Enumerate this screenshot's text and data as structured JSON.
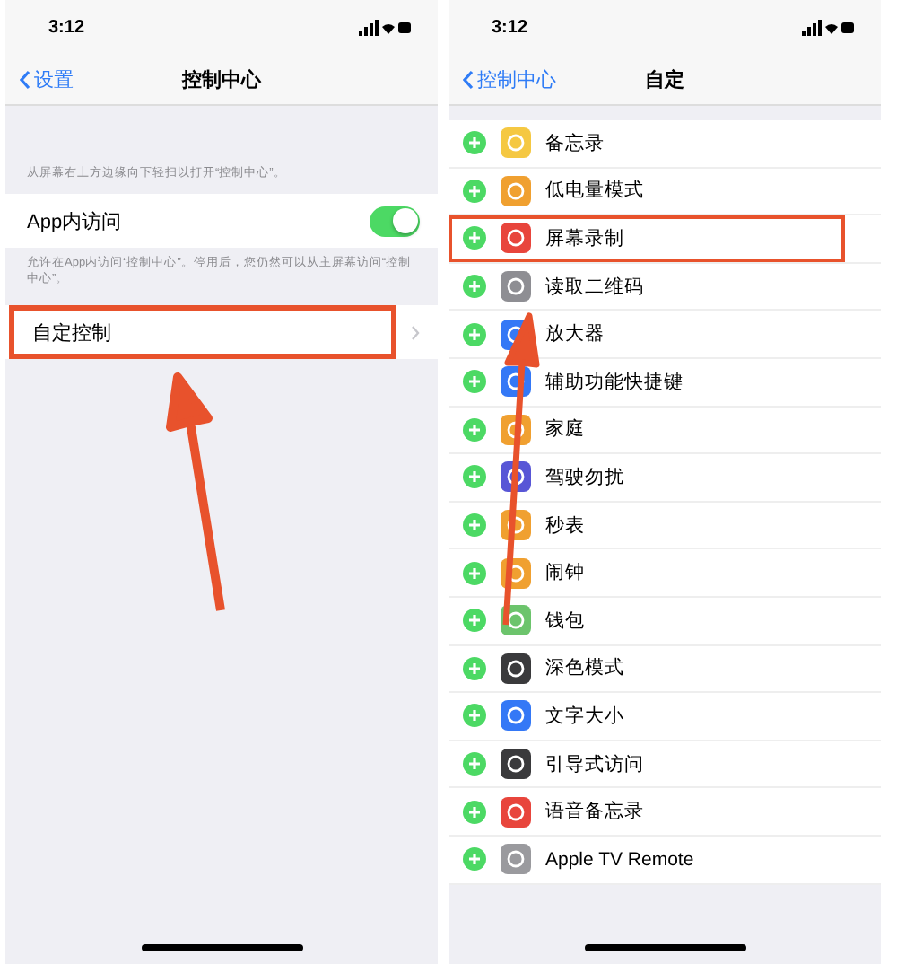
{
  "left_screen": {
    "status_bar": {
      "time": "3:12"
    },
    "nav": {
      "back": "设置",
      "title": "控制中心"
    },
    "intro": "从屏幕右上方边缘向下轻扫以打开“控制中心”。",
    "toggle_row": {
      "label": "App内访问",
      "on": true
    },
    "toggle_note": "允许在App内访问“控制中心”。停用后，您仍然可以从主屏幕访问“控制中心”。",
    "custom_row": {
      "label": "自定控制",
      "highlighted": true
    }
  },
  "right_screen": {
    "status_bar": {
      "time": "3:12"
    },
    "nav": {
      "back": "控制中心",
      "title": "自定"
    },
    "controls": [
      {
        "label": "备忘录",
        "color": "#f5c842",
        "highlighted": false
      },
      {
        "label": "低电量模式",
        "color": "#f0a030",
        "highlighted": false
      },
      {
        "label": "屏幕录制",
        "color": "#e8453c",
        "highlighted": true
      },
      {
        "label": "读取二维码",
        "color": "#8e8e93",
        "highlighted": false
      },
      {
        "label": "放大器",
        "color": "#3478f6",
        "highlighted": false
      },
      {
        "label": "辅助功能快捷键",
        "color": "#3478f6",
        "highlighted": false
      },
      {
        "label": "家庭",
        "color": "#f0a030",
        "highlighted": false
      },
      {
        "label": "驾驶勿扰",
        "color": "#5856d6",
        "highlighted": false
      },
      {
        "label": "秒表",
        "color": "#f0a030",
        "highlighted": false
      },
      {
        "label": "闹钟",
        "color": "#f0a030",
        "highlighted": false
      },
      {
        "label": "钱包",
        "color": "#6cc46c",
        "highlighted": false
      },
      {
        "label": "深色模式",
        "color": "#3a3a3c",
        "highlighted": false
      },
      {
        "label": "文字大小",
        "color": "#3478f6",
        "highlighted": false
      },
      {
        "label": "引导式访问",
        "color": "#3a3a3c",
        "highlighted": false
      },
      {
        "label": "语音备忘录",
        "color": "#e8453c",
        "highlighted": false
      },
      {
        "label": "Apple TV Remote",
        "color": "#9a9a9e",
        "highlighted": false
      }
    ]
  }
}
